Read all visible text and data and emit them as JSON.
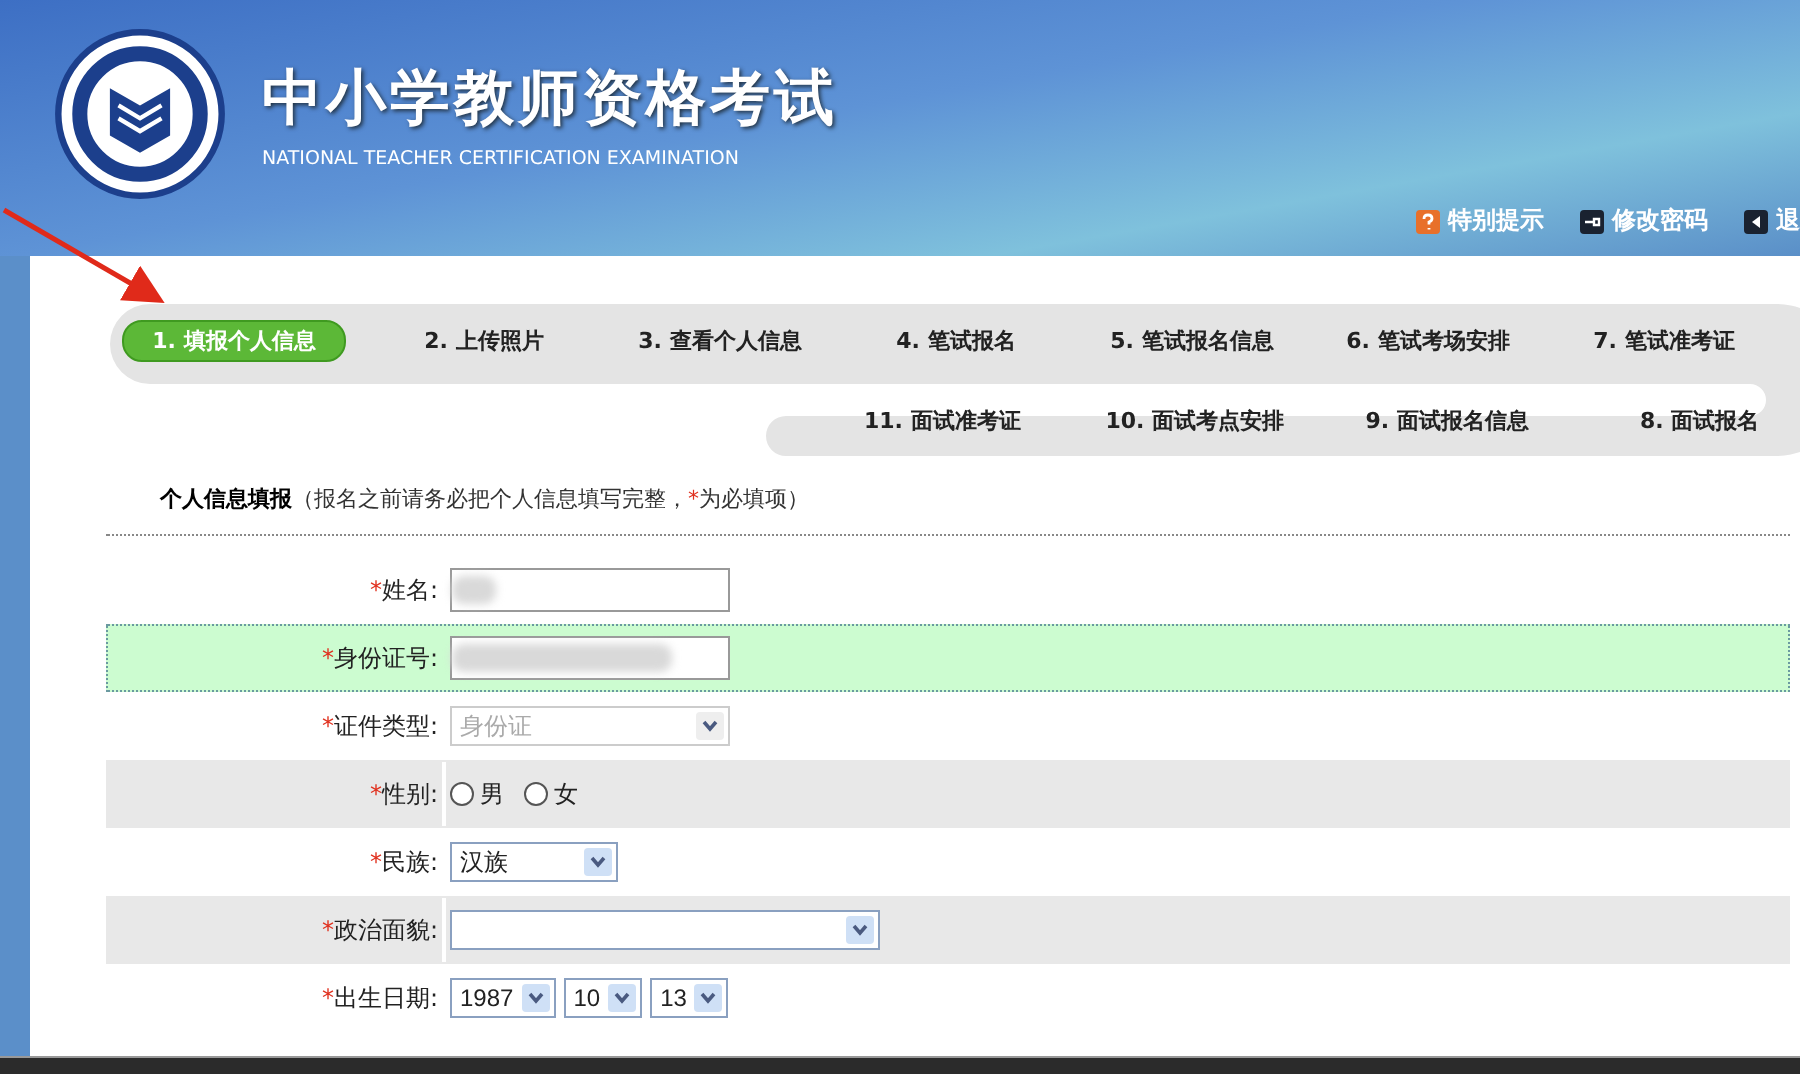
{
  "header": {
    "title": "中小学教师资格考试",
    "subtitle": "NATIONAL TEACHER CERTIFICATION EXAMINATION",
    "links": [
      {
        "kind": "tip",
        "label": "特别提示"
      },
      {
        "kind": "password",
        "label": "修改密码"
      },
      {
        "kind": "exit",
        "label": "退"
      }
    ]
  },
  "steps": {
    "top": [
      {
        "label": "1. 填报个人信息",
        "selected": true
      },
      {
        "label": "2. 上传照片",
        "selected": false
      },
      {
        "label": "3. 查看个人信息",
        "selected": false
      },
      {
        "label": "4. 笔试报名",
        "selected": false
      },
      {
        "label": "5. 笔试报名信息",
        "selected": false
      },
      {
        "label": "6. 笔试考场安排",
        "selected": false
      },
      {
        "label": "7. 笔试准考证",
        "selected": false
      }
    ],
    "bottom": [
      {
        "label": "11. 面试准考证",
        "selected": false
      },
      {
        "label": "10. 面试考点安排",
        "selected": false
      },
      {
        "label": "9. 面试报名信息",
        "selected": false
      },
      {
        "label": "8. 面试报名",
        "selected": false
      }
    ]
  },
  "form": {
    "title": "个人信息填报",
    "note_open": "（报名之前请务必把个人信息填写完整，",
    "note_mark": "*",
    "note_close": "为必填项）",
    "fields": [
      {
        "kind": "text",
        "mark": "*",
        "label": "姓名:",
        "focused": false,
        "redacted": true
      },
      {
        "kind": "text",
        "mark": "*",
        "label": "身份证号:",
        "focused": true,
        "redacted": true
      },
      {
        "kind": "select",
        "mark": "*",
        "label": "证件类型:",
        "focused": false,
        "disabled": true,
        "value": "身份证"
      },
      {
        "kind": "radio",
        "mark": "*",
        "label": "性别:",
        "focused": false,
        "options": [
          {
            "label": "男",
            "selected": false
          },
          {
            "label": "女",
            "selected": false
          }
        ]
      },
      {
        "kind": "select",
        "mark": "*",
        "label": "民族:",
        "focused": false,
        "disabled": false,
        "value": "汉族"
      },
      {
        "kind": "select",
        "mark": "*",
        "label": "政治面貌:",
        "focused": false,
        "disabled": false
      },
      {
        "kind": "date",
        "mark": "*",
        "label": "出生日期:",
        "focused": false,
        "parts": [
          "1987",
          "10",
          "13"
        ]
      }
    ]
  }
}
